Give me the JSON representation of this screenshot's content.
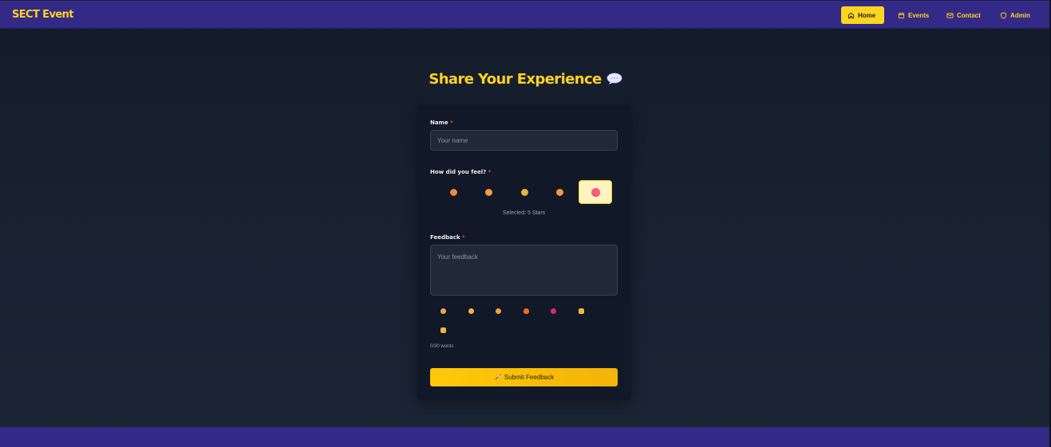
{
  "navbar": {
    "brand": "SECT Event",
    "items": [
      {
        "label": "Home",
        "icon": "home-icon",
        "active": true
      },
      {
        "label": "Events",
        "icon": "calendar-icon"
      },
      {
        "label": "Contact",
        "icon": "mail-icon"
      },
      {
        "label": "Admin",
        "icon": "shield-icon"
      }
    ]
  },
  "page": {
    "title": "Share Your Experience",
    "title_icon": "speech-bubble-icon"
  },
  "form": {
    "name_label": "Name",
    "name_placeholder": "Your name",
    "feel_label": "How did you feel?",
    "required_mark": "*",
    "ratings": [
      {
        "icon": "angry-face-icon"
      },
      {
        "icon": "sad-face-icon"
      },
      {
        "icon": "neutral-face-icon"
      },
      {
        "icon": "smiling-face-icon"
      },
      {
        "icon": "star-struck-face-icon",
        "selected": true
      }
    ],
    "selected_text": "Selected: 5 Stars",
    "feedback_label": "Feedback",
    "feedback_placeholder": "Your feedback",
    "emoji_bar": [
      {
        "icon": "grinning-face-emoji"
      },
      {
        "icon": "expressionless-face-emoji"
      },
      {
        "icon": "laughing-face-emoji"
      },
      {
        "icon": "fire-emoji"
      },
      {
        "icon": "sparkling-heart-emoji"
      },
      {
        "icon": "thumbs-up-emoji"
      },
      {
        "icon": "thumbs-down-emoji"
      }
    ],
    "word_count": "0/30 words",
    "submit_label": "Submit Feedback",
    "submit_icon": "rocket-icon"
  },
  "colors": {
    "accent": "#ffd21f",
    "navbar_bg": "#332a87",
    "card_bg": "#111827",
    "input_bg": "#1f2937",
    "required": "#ef4444"
  }
}
